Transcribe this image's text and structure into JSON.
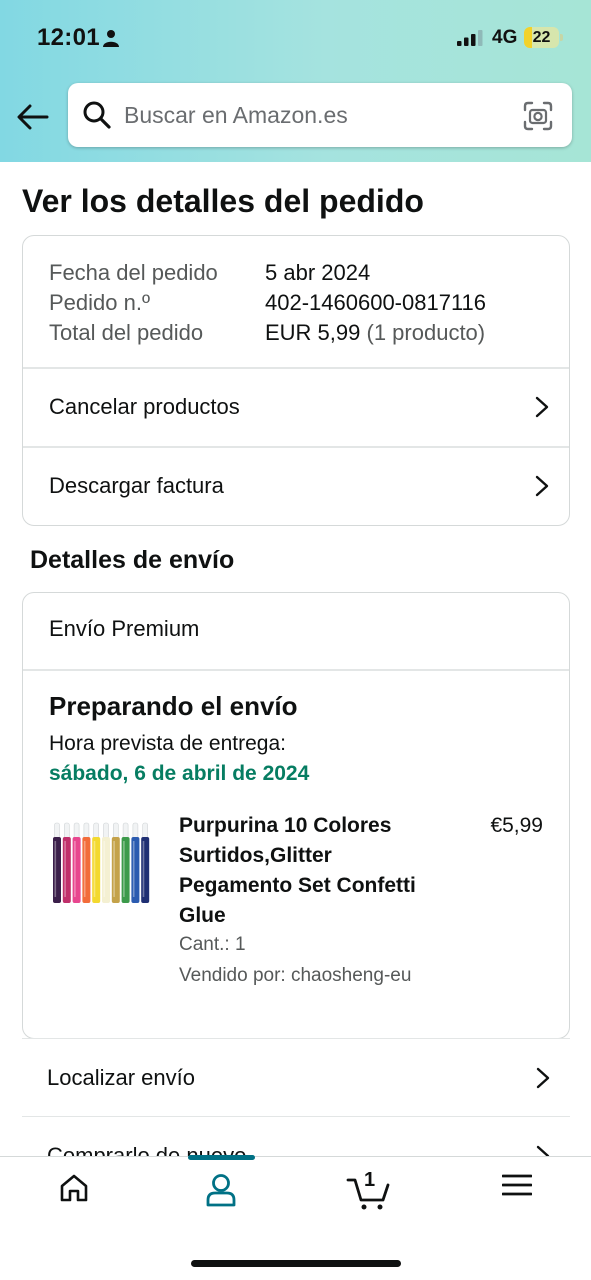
{
  "status_bar": {
    "time": "12:01",
    "network": "4G",
    "battery": "22",
    "battery_level": 0.22
  },
  "search": {
    "placeholder": "Buscar en Amazon.es"
  },
  "page_title": "Ver los detalles del pedido",
  "order_summary": {
    "rows": [
      {
        "label": "Fecha del pedido",
        "value": "5 abr 2024",
        "extra": ""
      },
      {
        "label": "Pedido n.º",
        "value": "402-1460600-0817116",
        "extra": ""
      },
      {
        "label": "Total del pedido",
        "value": "EUR 5,99",
        "extra": " (1 producto)"
      }
    ],
    "links": [
      "Cancelar productos",
      "Descargar factura"
    ]
  },
  "shipping": {
    "section_title": "Detalles de envío",
    "type": "Envío Premium",
    "status": "Preparando el envío",
    "eta_label": "Hora prevista de entrega:",
    "eta_date": "sábado, 6 de abril de 2024",
    "product": {
      "title": "Purpurina 10 Colores Surtidos,Glitter Pegamento Set Confetti Glue",
      "price": "€5,99",
      "qty": "Cant.: 1",
      "seller": "Vendido por: chaosheng-eu",
      "tube_colors": [
        "#3b1f4a",
        "#c0306b",
        "#e8478f",
        "#f26c3a",
        "#f3d92f",
        "#f4f0d2",
        "#c4a24a",
        "#3c9a4b",
        "#2b5bb0",
        "#1f2f73"
      ]
    }
  },
  "actions": [
    "Localizar envío",
    "Comprarlo de nuevo"
  ],
  "tabbar": {
    "cart_count": "1",
    "accent": "#007185"
  },
  "colors": {
    "eta_green": "#067d62",
    "accent": "#007185"
  }
}
